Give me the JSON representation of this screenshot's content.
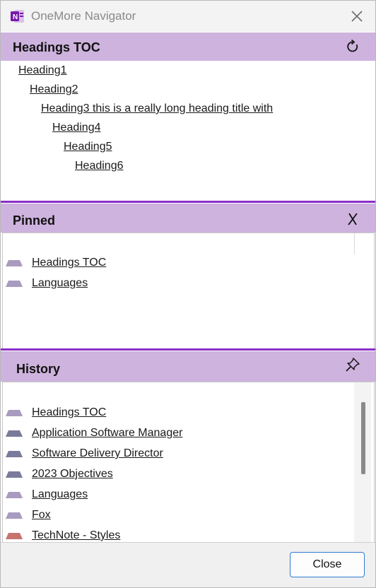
{
  "window": {
    "title": "OneMore Navigator"
  },
  "headings": {
    "title": "Headings TOC",
    "refresh_icon": "refresh-icon",
    "items": [
      {
        "label": "Heading1"
      },
      {
        "label": "Heading2"
      },
      {
        "label": "Heading3 this is a really long heading title with "
      },
      {
        "label": "Heading4"
      },
      {
        "label": "Heading5"
      },
      {
        "label": "Heading6"
      }
    ]
  },
  "pinned": {
    "title": "Pinned",
    "unpin_icon": "x-mark-icon",
    "items": [
      {
        "label": "Headings TOC",
        "color": "#a99bbf"
      },
      {
        "label": "Languages",
        "color": "#a99bbf"
      }
    ]
  },
  "history": {
    "title": "History",
    "pin_icon": "pin-icon",
    "items": [
      {
        "label": "Headings TOC",
        "color": "#a99bbf"
      },
      {
        "label": "Application Software Manager",
        "color": "#7a7a9a"
      },
      {
        "label": "Software Delivery Director",
        "color": "#7a7a9a"
      },
      {
        "label": "2023 Objectives",
        "color": "#7a7a9a"
      },
      {
        "label": "Languages",
        "color": "#a99bbf"
      },
      {
        "label": "Fox",
        "color": "#a99bbf"
      },
      {
        "label": "TechNote - Styles",
        "color": "#c4736e"
      }
    ]
  },
  "footer": {
    "close_label": "Close"
  },
  "colors": {
    "accent": "#8a2dc9",
    "header_bg": "#cdb3dd",
    "button_border": "#2f7bd4"
  }
}
